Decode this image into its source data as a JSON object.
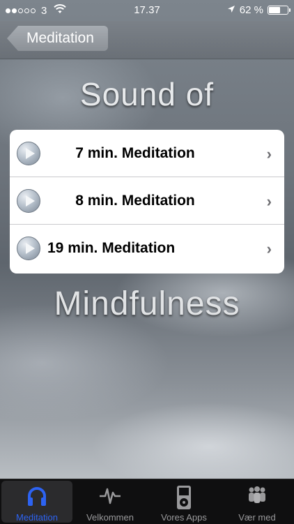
{
  "status_bar": {
    "carrier": "3",
    "time": "17.37",
    "battery_percent": "62 %",
    "battery_level": 0.62
  },
  "nav": {
    "back_label": "Meditation"
  },
  "headings": {
    "top": "Sound of",
    "bottom": "Mindfulness"
  },
  "list": {
    "items": [
      {
        "label": "7 min. Meditation"
      },
      {
        "label": "8 min. Meditation"
      },
      {
        "label": "19 min. Meditation"
      }
    ]
  },
  "tabbar": {
    "tabs": [
      {
        "label": "Meditation",
        "icon": "headphones-icon",
        "active": true
      },
      {
        "label": "Velkommen",
        "icon": "pulse-icon",
        "active": false
      },
      {
        "label": "Vores Apps",
        "icon": "ipod-icon",
        "active": false
      },
      {
        "label": "Vær med",
        "icon": "people-icon",
        "active": false
      }
    ],
    "active_color": "#2d63f2"
  }
}
